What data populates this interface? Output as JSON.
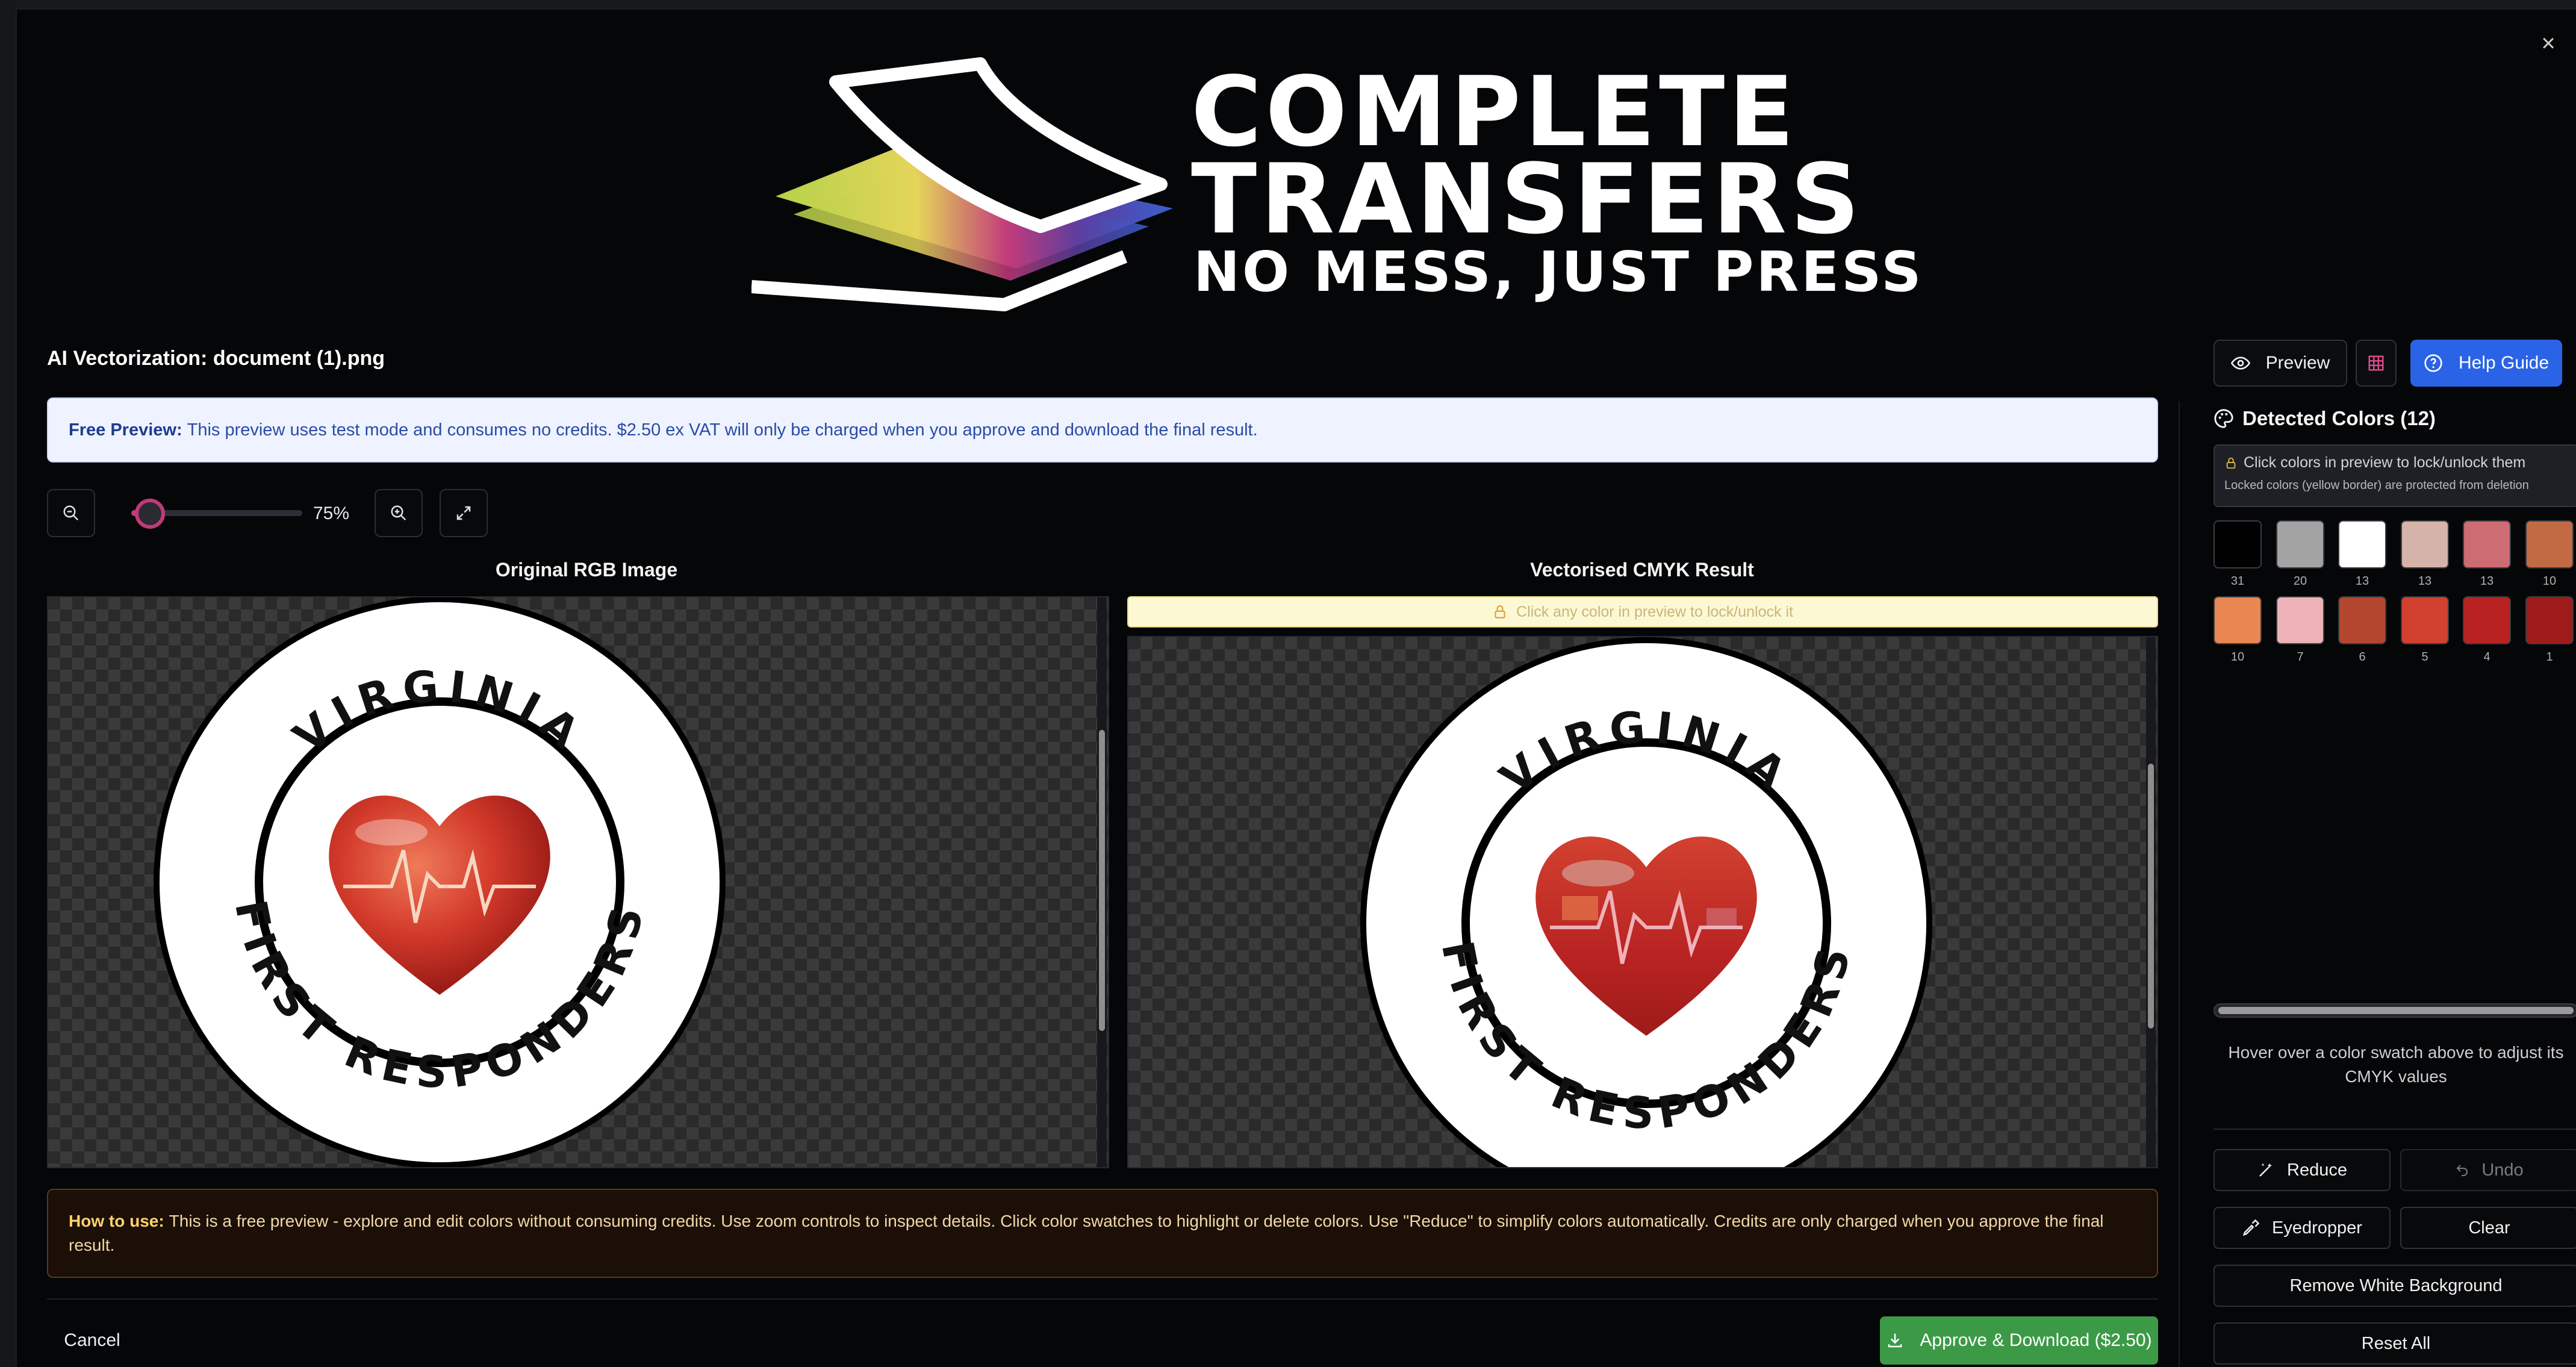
{
  "logo": {
    "line1": "COMPLETE",
    "line2": "TRANSFERS",
    "line3": "NO MESS, JUST PRESS"
  },
  "header": {
    "title": "AI Vectorization: document (1).png",
    "preview_label": "Preview",
    "help_label": "Help Guide"
  },
  "info_banner": {
    "bold": "Free Preview:",
    "text": "This preview uses test mode and consumes no credits. $2.50 ex VAT will only be charged when you approve and download the final result."
  },
  "zoom": {
    "value_label": "75%",
    "level": 0.05
  },
  "panels": {
    "original_label": "Original RGB Image",
    "result_label": "Vectorised CMYK Result",
    "lock_hint": "Click any color in preview to lock/unlock it"
  },
  "badge": {
    "top_text": "VIRGINIA",
    "bottom_text": "FIRST RESPONDERS"
  },
  "sidebar": {
    "title": "Detected Colors (12)",
    "lock_note_1": "Click colors in preview to lock/unlock them",
    "lock_note_2": "Locked colors (yellow border) are protected from deletion",
    "colors": [
      {
        "hex": "#000000",
        "count": "31"
      },
      {
        "hex": "#a3a3a3",
        "count": "20"
      },
      {
        "hex": "#ffffff",
        "count": "13"
      },
      {
        "hex": "#d5b3a8",
        "count": "13"
      },
      {
        "hex": "#cd6c73",
        "count": "13"
      },
      {
        "hex": "#c26a44",
        "count": "10"
      },
      {
        "hex": "#ea8651",
        "count": "10"
      },
      {
        "hex": "#efb2b9",
        "count": "7"
      },
      {
        "hex": "#b4462f",
        "count": "6"
      },
      {
        "hex": "#d24130",
        "count": "5"
      },
      {
        "hex": "#b82322",
        "count": "4"
      },
      {
        "hex": "#9e1b1a",
        "count": "1"
      }
    ],
    "hover_hint": "Hover over a color swatch above to adjust its CMYK values",
    "reduce_label": "Reduce",
    "undo_label": "Undo",
    "eyedropper_label": "Eyedropper",
    "clear_label": "Clear",
    "remove_white_label": "Remove White Background",
    "reset_label": "Reset All"
  },
  "howto": {
    "bold": "How to use:",
    "text": "This is a free preview - explore and edit colors without consuming credits. Use zoom controls to inspect details. Click color swatches to highlight or delete colors. Use \"Reduce\" to simplify colors automatically. Credits are only charged when you approve the final result."
  },
  "footer": {
    "cancel_label": "Cancel",
    "approve_label": "Approve & Download ($2.50)"
  },
  "colors": {
    "accent_blue": "#2b63e6",
    "accent_green": "#3c9a47",
    "slider_pink": "#c23a7a"
  }
}
